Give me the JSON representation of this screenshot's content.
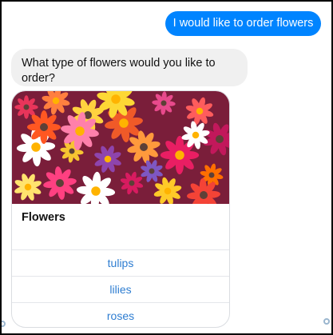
{
  "colors": {
    "user_bubble": "#0084ff",
    "bot_bubble": "#f0f0f0",
    "link": "#2e7dd1"
  },
  "messages": {
    "user": "I would like to order flowers",
    "bot": "What type of flowers would you like to order?"
  },
  "card": {
    "image_icon": "flower-bouquet-photo",
    "title": "Flowers",
    "buttons": [
      {
        "label": "tulips"
      },
      {
        "label": "lilies"
      },
      {
        "label": "roses"
      }
    ]
  }
}
